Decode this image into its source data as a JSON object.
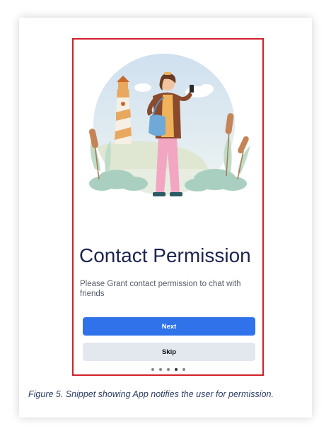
{
  "screen": {
    "title": "Contact Permission",
    "subtitle": "Please Grant contact permission to chat with friends",
    "next_label": "Next",
    "skip_label": "Skip",
    "page_indicator": {
      "total": 5,
      "current": 4
    }
  },
  "figure": {
    "caption": "Figure 5. Snippet showing App notifies the user for permission."
  },
  "illustration": {
    "icon": "person-with-phone-lighthouse-illustration"
  },
  "colors": {
    "frame_border": "#d0202a",
    "primary_button": "#2f72ea",
    "secondary_button": "#e3e8ef",
    "title_text": "#1d2450",
    "caption_text": "#2c3d63"
  }
}
